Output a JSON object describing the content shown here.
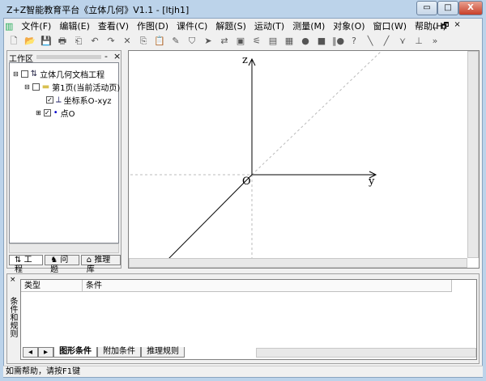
{
  "window": {
    "title": "Z+Z智能教育平台《立体几何》V1.1 - [ltjh1]",
    "min": "▭",
    "max": "□",
    "close": "X"
  },
  "menu": [
    "文件(F)",
    "编辑(E)",
    "查看(V)",
    "作图(D)",
    "课件(C)",
    "解题(S)",
    "运动(T)",
    "测量(M)",
    "对象(O)",
    "窗口(W)",
    "帮助(H)"
  ],
  "mdi": {
    "min": "_",
    "restore": "🗗",
    "close": "×"
  },
  "toolbar": [
    "🗋",
    "📂",
    "💾",
    "🖶",
    "⎗",
    "↶",
    "↷",
    "✕",
    "⎘",
    "📋",
    "✎",
    "⛉",
    "➤",
    "⇄",
    "▣",
    "⚟",
    "▤",
    "▦",
    "●",
    "■",
    "‖●",
    "?",
    "╲",
    "╱",
    "⋎",
    "⊥",
    "»"
  ],
  "workspace": {
    "title": "工作区",
    "close": "×",
    "pin": "-",
    "tree": [
      {
        "label": "立体几何文档工程",
        "check": ""
      },
      {
        "label": "第1页(当前活动页)",
        "check": ""
      },
      {
        "label": "坐标系O-xyz",
        "check": "✓"
      },
      {
        "label": "点O",
        "check": "✓"
      }
    ],
    "tabs": [
      "工程",
      "问题",
      "推理库"
    ]
  },
  "canvas": {
    "axis_z": "z",
    "axis_y": "y",
    "origin": "O"
  },
  "bottom": {
    "side_title": "条件和规则",
    "close": "×",
    "columns": [
      "类型",
      "条件"
    ],
    "tabs": [
      "图形条件",
      "附加条件",
      "推理规则"
    ]
  },
  "status": "如需帮助，请按F1键"
}
